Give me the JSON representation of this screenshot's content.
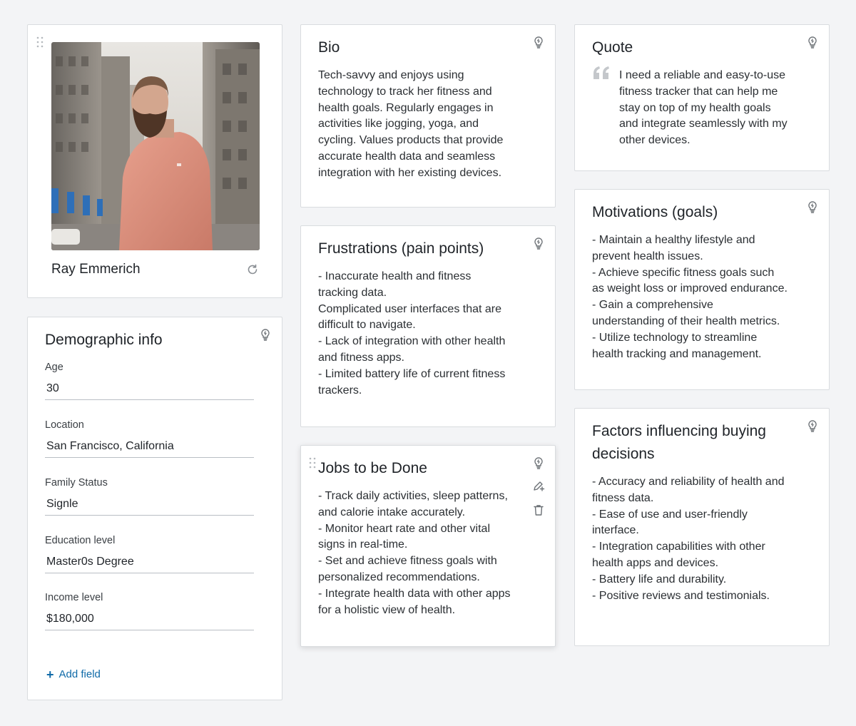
{
  "profile": {
    "name": "Ray Emmerich",
    "photo_alt": "Portrait of Ray Emmerich",
    "refresh_icon": "refresh-icon",
    "drag_icon": "drag-handle-icon"
  },
  "demographic": {
    "title": "Demographic info",
    "fields": [
      {
        "label": "Age",
        "value": "30"
      },
      {
        "label": "Location",
        "value": "San Francisco, California"
      },
      {
        "label": "Family Status",
        "value": "Signle"
      },
      {
        "label": "Education level",
        "value": "Master0s Degree"
      },
      {
        "label": "Income level",
        "value": "$180,000"
      }
    ],
    "add_field_label": "Add field"
  },
  "bio": {
    "title": "Bio",
    "text": "Tech-savvy and enjoys using\ntechnology to track her fitness and\nhealth goals. Regularly engages in\nactivities like jogging, yoga, and\ncycling. Values products that provide\naccurate health data and seamless\nintegration with her existing devices."
  },
  "frustrations": {
    "title": "Frustrations (pain points)",
    "text": "- Inaccurate health and fitness\ntracking data.\nComplicated user interfaces that are\ndifficult to navigate.\n- Lack of integration with other health\nand fitness apps.\n- Limited battery life of current fitness\ntrackers."
  },
  "jobs": {
    "title": "Jobs to be Done",
    "text": "- Track daily activities, sleep patterns,\nand calorie intake accurately.\n- Monitor heart rate and other vital\nsigns in real-time.\n- Set and achieve fitness goals with\npersonalized recommendations.\n- Integrate health data with other apps\nfor a holistic view of health."
  },
  "quote": {
    "title": "Quote",
    "text": "I need a reliable and easy-to-use\nfitness tracker that can help me\nstay on top of my health goals\nand integrate seamlessly with my\nother devices."
  },
  "motivations": {
    "title": "Motivations (goals)",
    "text": "- Maintain a healthy lifestyle and\nprevent health issues.\n- Achieve specific fitness goals such\nas weight loss or improved endurance.\n- Gain a comprehensive\nunderstanding of their health metrics.\n- Utilize technology to streamline\nhealth tracking and management."
  },
  "factors": {
    "title": "Factors influencing buying\ndecisions",
    "text": "- Accuracy and reliability of health and\nfitness data.\n- Ease of use and user-friendly\ninterface.\n- Integration capabilities with other\nhealth apps and devices.\n- Battery life and durability.\n- Positive reviews and testimonials."
  },
  "colors": {
    "background": "#f3f4f6",
    "card": "#ffffff",
    "border": "#d9dcdf",
    "link": "#0f6aa8",
    "icon": "#6b7075"
  }
}
